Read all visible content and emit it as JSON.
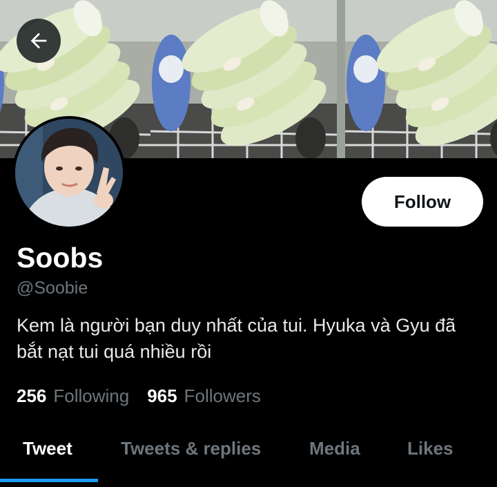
{
  "header": {
    "back_icon": "arrow-left-icon"
  },
  "profile": {
    "display_name": "Soobs",
    "handle": "@Soobie",
    "bio": "Kem là người bạn duy nhất của tui. Hyuka và Gyu đã bắt nạt tui quá nhiều rồi",
    "follow_label": "Follow"
  },
  "stats": {
    "following_count": "256",
    "following_label": "Following",
    "followers_count": "965",
    "followers_label": "Followers"
  },
  "tabs": [
    {
      "label": "Tweet",
      "active": true
    },
    {
      "label": "Tweets & replies",
      "active": false
    },
    {
      "label": "Media",
      "active": false
    },
    {
      "label": "Likes",
      "active": false
    }
  ],
  "colors": {
    "accent": "#1d9bf0",
    "background": "#000000",
    "muted_text": "#6e767d"
  }
}
